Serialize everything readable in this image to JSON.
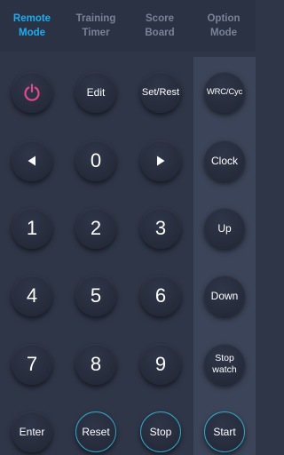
{
  "tabs": [
    {
      "line1": "Remote",
      "line2": "Mode",
      "active": true
    },
    {
      "line1": "Training",
      "line2": "Timer",
      "active": false
    },
    {
      "line1": "Score",
      "line2": "Board",
      "active": false
    },
    {
      "line1": "Option",
      "line2": "Mode",
      "active": false
    }
  ],
  "buttons": {
    "power": {
      "icon": "power-icon",
      "color": "#e8468f"
    },
    "edit": "Edit",
    "set_rest": "Set/Rest",
    "wrc_cyc": "WRC/Cyc",
    "left": {
      "icon": "triangle-left-icon"
    },
    "zero": "0",
    "right": {
      "icon": "triangle-right-icon"
    },
    "clock": "Clock",
    "one": "1",
    "two": "2",
    "three": "3",
    "up": "Up",
    "four": "4",
    "five": "5",
    "six": "6",
    "down": "Down",
    "seven": "7",
    "eight": "8",
    "nine": "9",
    "stopwatch_line1": "Stop",
    "stopwatch_line2": "watch",
    "enter": "Enter",
    "reset": "Reset",
    "stop": "Stop",
    "start": "Start"
  },
  "colors": {
    "accent": "#19aef0",
    "ring": "#2ea7c6",
    "background": "#2f3648",
    "side_panel": "#3b4458"
  }
}
